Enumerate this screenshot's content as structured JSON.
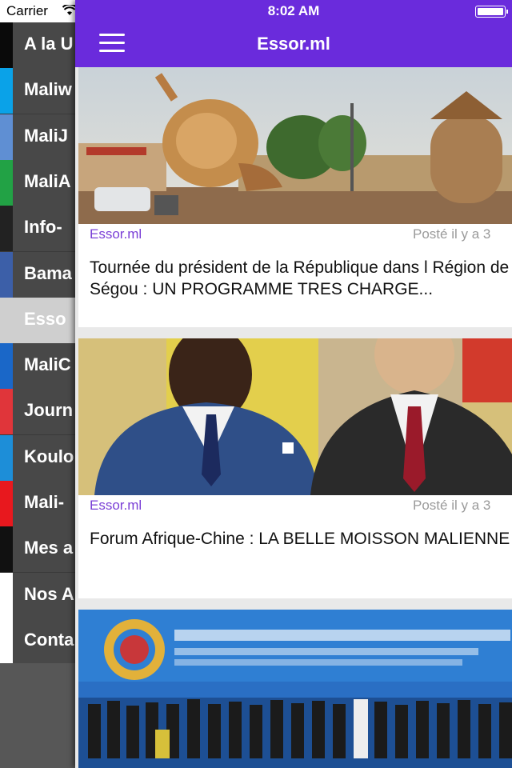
{
  "status_bar": {
    "carrier": "Carrier",
    "time": "8:02 AM"
  },
  "header": {
    "title": "Essor.ml"
  },
  "drawer": {
    "items": [
      {
        "label": "A la U",
        "color": "#0a0a0a"
      },
      {
        "label": "Maliw",
        "color": "#0aa2e8"
      },
      {
        "label": "MaliJ",
        "color": "#5f8fd3"
      },
      {
        "label": "MaliA",
        "color": "#22a245"
      },
      {
        "label": "Info-",
        "color": "#222222"
      },
      {
        "label": "Bama",
        "color": "#3c5fa8"
      },
      {
        "label": "Esso",
        "color": "#cfcfcf"
      },
      {
        "label": "MaliC",
        "color": "#1a67c8"
      },
      {
        "label": "Journ",
        "color": "#e0353a"
      },
      {
        "label": "Koulo",
        "color": "#1d8ed8"
      },
      {
        "label": "Mali-",
        "color": "#e8181e"
      },
      {
        "label": "Mes a",
        "color": "#111111"
      },
      {
        "label": "Nos A",
        "color": "#ffffff"
      },
      {
        "label": "Conta",
        "color": "#ffffff"
      }
    ]
  },
  "articles": [
    {
      "source": "Essor.ml",
      "date": "Posté il y a 3",
      "headline": "Tournée du président de la République dans l Région de Ségou : UN PROGRAMME TRES CHARGE..."
    },
    {
      "source": "Essor.ml",
      "date": "Posté il y a 3",
      "headline": "Forum Afrique-Chine : LA BELLE MOISSON MALIENNE"
    }
  ],
  "colors": {
    "accent": "#6a2bdc",
    "source_text": "#7a3fd6"
  }
}
